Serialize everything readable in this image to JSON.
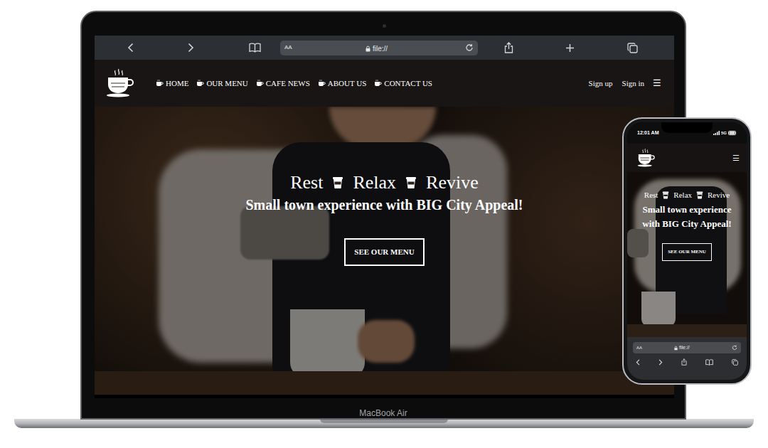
{
  "laptop": {
    "label": "MacBook Air",
    "browser": {
      "reader_button": "AA",
      "address": "file://"
    },
    "site": {
      "nav": [
        "HOME",
        "OUR MENU",
        "CAFE NEWS",
        "ABOUT US",
        "CONTACT US"
      ],
      "auth": [
        "Sign up",
        "Sign in"
      ],
      "menu_icon": "☰",
      "hero": {
        "words": [
          "Rest",
          "Relax",
          "Revive"
        ],
        "tagline": "Small town experience with BIG City Appeal!",
        "button": "SEE OUR MENU"
      }
    }
  },
  "phone": {
    "status_bar": {
      "time": "12:01 AM",
      "network": "5G"
    },
    "site": {
      "menu_icon": "☰",
      "hero": {
        "words": [
          "Rest",
          "Relax",
          "Revive"
        ],
        "tagline": "Small town experience with BIG City Appeal!",
        "button": "SEE OUR MENU"
      }
    },
    "browser": {
      "reader_button": "AA",
      "address": "file://"
    }
  }
}
